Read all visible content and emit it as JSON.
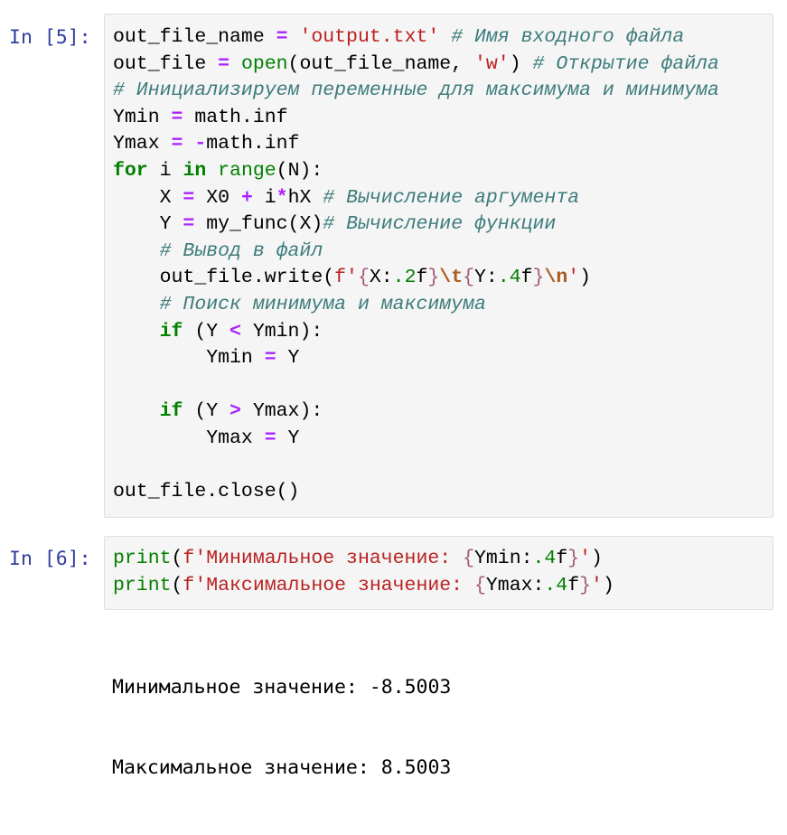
{
  "cells": [
    {
      "prompt": "In [5]:",
      "lines": [
        [
          [
            "out_file_name ",
            ""
          ],
          [
            "=",
            "op"
          ],
          [
            " ",
            ""
          ],
          [
            "'output.txt'",
            "st"
          ],
          [
            " ",
            ""
          ],
          [
            "# Имя входного файла",
            "cm"
          ]
        ],
        [
          [
            "out_file ",
            ""
          ],
          [
            "=",
            "op"
          ],
          [
            " ",
            ""
          ],
          [
            "open",
            "bi"
          ],
          [
            "(out_file_name, ",
            ""
          ],
          [
            "'w'",
            "st"
          ],
          [
            ") ",
            ""
          ],
          [
            "# Открытие файла",
            "cm"
          ]
        ],
        [
          [
            "# Инициализируем переменные для максимума и минимума",
            "cm"
          ]
        ],
        [
          [
            "Ymin ",
            ""
          ],
          [
            "=",
            "op"
          ],
          [
            " math.inf",
            ""
          ]
        ],
        [
          [
            "Ymax ",
            ""
          ],
          [
            "=",
            "op"
          ],
          [
            " ",
            ""
          ],
          [
            "-",
            "op"
          ],
          [
            "math.inf",
            ""
          ]
        ],
        [
          [
            "for",
            "kw"
          ],
          [
            " i ",
            ""
          ],
          [
            "in",
            "kw"
          ],
          [
            " ",
            ""
          ],
          [
            "range",
            "bi"
          ],
          [
            "(N):",
            ""
          ]
        ],
        [
          [
            "    X ",
            ""
          ],
          [
            "=",
            "op"
          ],
          [
            " X0 ",
            ""
          ],
          [
            "+",
            "op"
          ],
          [
            " i",
            ""
          ],
          [
            "*",
            "op"
          ],
          [
            "hX ",
            ""
          ],
          [
            "# Вычисление аргумента",
            "cm"
          ]
        ],
        [
          [
            "    Y ",
            ""
          ],
          [
            "=",
            "op"
          ],
          [
            " my_func(X)",
            ""
          ],
          [
            "# Вычисление функции",
            "cm"
          ]
        ],
        [
          [
            "    ",
            ""
          ],
          [
            "# Вывод в файл",
            "cm"
          ]
        ],
        [
          [
            "    out_file.write(",
            ""
          ],
          [
            "f'",
            "st"
          ],
          [
            "{",
            "si"
          ],
          [
            "X:",
            ""
          ],
          [
            ".2",
            "num"
          ],
          [
            "f",
            ""
          ],
          [
            "}",
            "si"
          ],
          [
            "\\t",
            "esc"
          ],
          [
            "{",
            "si"
          ],
          [
            "Y:",
            ""
          ],
          [
            ".4",
            "num"
          ],
          [
            "f",
            ""
          ],
          [
            "}",
            "si"
          ],
          [
            "\\n",
            "esc"
          ],
          [
            "'",
            "st"
          ],
          [
            ")",
            ""
          ]
        ],
        [
          [
            "    ",
            ""
          ],
          [
            "# Поиск минимума и максимума",
            "cm"
          ]
        ],
        [
          [
            "    ",
            ""
          ],
          [
            "if",
            "kw"
          ],
          [
            " (Y ",
            ""
          ],
          [
            "<",
            "op"
          ],
          [
            " Ymin):",
            ""
          ]
        ],
        [
          [
            "        Ymin ",
            ""
          ],
          [
            "=",
            "op"
          ],
          [
            " Y",
            ""
          ]
        ],
        [
          [
            "",
            ""
          ]
        ],
        [
          [
            "    ",
            ""
          ],
          [
            "if",
            "kw"
          ],
          [
            " (Y ",
            ""
          ],
          [
            ">",
            "op"
          ],
          [
            " Ymax):",
            ""
          ]
        ],
        [
          [
            "        Ymax ",
            ""
          ],
          [
            "=",
            "op"
          ],
          [
            " Y",
            ""
          ]
        ],
        [
          [
            "",
            ""
          ]
        ],
        [
          [
            "out_file.close()",
            ""
          ]
        ]
      ],
      "output": []
    },
    {
      "prompt": "In [6]:",
      "lines": [
        [
          [
            "print",
            "bi"
          ],
          [
            "(",
            ""
          ],
          [
            "f'Минимальное значение: ",
            "st"
          ],
          [
            "{",
            "si"
          ],
          [
            "Ymin:",
            ""
          ],
          [
            ".4",
            "num"
          ],
          [
            "f",
            ""
          ],
          [
            "}",
            "si"
          ],
          [
            "'",
            "st"
          ],
          [
            ")",
            ""
          ]
        ],
        [
          [
            "print",
            "bi"
          ],
          [
            "(",
            ""
          ],
          [
            "f'Максимальное значение: ",
            "st"
          ],
          [
            "{",
            "si"
          ],
          [
            "Ymax:",
            ""
          ],
          [
            ".4",
            "num"
          ],
          [
            "f",
            ""
          ],
          [
            "}",
            "si"
          ],
          [
            "'",
            "st"
          ],
          [
            ")",
            ""
          ]
        ]
      ],
      "output": [
        "Минимальное значение: -8.5003",
        "Максимальное значение: 8.5003"
      ]
    }
  ]
}
